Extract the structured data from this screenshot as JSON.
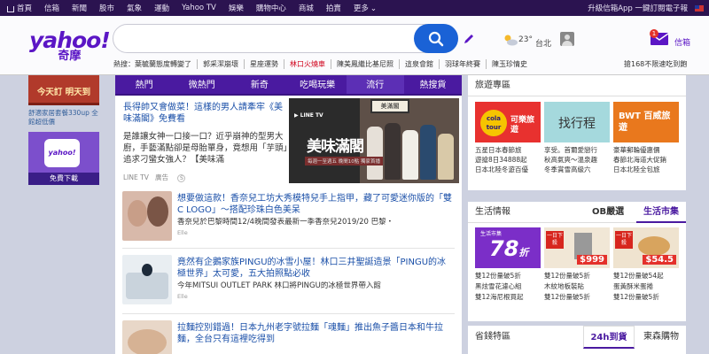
{
  "topnav": {
    "items": [
      "首頁",
      "信箱",
      "新聞",
      "股市",
      "氣象",
      "運動",
      "Yahoo TV",
      "娛樂",
      "購物中心",
      "商城",
      "拍賣",
      "更多"
    ],
    "more_chevron": "⌄",
    "right_label": "升級信箱App 一鍵訂閱電子報"
  },
  "logo": {
    "text": "yahoo!",
    "sub": "奇摩"
  },
  "search": {
    "placeholder": "",
    "value": ""
  },
  "weather": {
    "temp": "23°",
    "city": "台北"
  },
  "mail": {
    "badge": "1",
    "label": "信箱"
  },
  "hot_searches": {
    "label": "熱搜：",
    "items": [
      "葉毓蘭態度轉變了",
      "郭采潔崩壞",
      "星座運勢",
      "林口火燒車",
      "陳美鳳繼比基尼照",
      "這泉會館",
      "羽球年終賽",
      "陳玉珍情史"
    ],
    "right": "搶168不限速吃到飽"
  },
  "left_ads": {
    "banner1_top": "今天訂 明天到",
    "banner1_big": "今天訂 明天到",
    "text": "舒適家居套餐330up 全館超低價",
    "banner2_inner": "yahoo!",
    "banner2_dl": "免費下載"
  },
  "tabs": [
    "熱門",
    "微熱門",
    "新奇",
    "吃喝玩樂",
    "流行",
    "熱搜貨"
  ],
  "hero": {
    "title": "長得帥又會做菜！這樣的男人請牽牢《美味滿閣》免費看",
    "desc": "是誰讓女神一口接一口？近乎崩神的型男大廚，手藝滿點卻是母胎單身，竟想用「芋頭」追求刁蠻女強人？【美味滿",
    "source": "LINE TV",
    "ad": "廣告",
    "img_logo": "▶ LINE TV",
    "img_show": "美味滿閣",
    "img_sub": "每週一至週五 晚間10點 獨家首播",
    "img_sign": "美滿閣"
  },
  "feed": [
    {
      "title": "想要做這款！香奈兒工坊大秀模特兒手上指甲，藏了可愛迷你版的「雙C LOGO」～搭配珍珠白色美呆",
      "desc": "香奈兒於巴黎時間12/4晚間發表最新一季香奈兒2019/20 巴黎・",
      "source": "Elle"
    },
    {
      "title": "竟然有企鵝家族PINGU的冰雪小屋！林口三井聖誕造景「PINGU的冰極世界」太可愛，五大拍照點必收",
      "desc": "今年MITSUI OUTLET PARK 林口將PINGU的冰極世界帶入館",
      "source": "Elle"
    },
    {
      "title": "拉麵控別錯過！日本九州老字號拉麵「魂麵」推出魚子醬日本和牛拉麵，全台只有這裡吃得到",
      "desc": "",
      "source": ""
    }
  ],
  "travel": {
    "header": "旅遊專區",
    "cards": [
      {
        "brand": "可樂旅遊",
        "logo_text": "cola tour",
        "text1": "五星日本春節旅",
        "text2": "遊搶8日34888起"
      },
      {
        "brand": "找行程",
        "logo_text": "找行程",
        "text1": "享受。首爾愛戀行",
        "text2": "秋高氣爽～溫泉趣"
      },
      {
        "brand": "百威旅遊",
        "logo_text": "BWT 百威旅遊",
        "text1": "豪華郵輪優惠價",
        "text2": "春節北海道大促銷"
      }
    ],
    "card_extra": [
      "日本北陸冬遊百優",
      "冬季賞雪高級六",
      "日本北陸全包旅"
    ]
  },
  "life": {
    "header": "生活情報",
    "tab_ob": "OB嚴選",
    "tab_market": "生活市集",
    "cards": [
      {
        "badge": "生活市集",
        "big": "78",
        "unit": "折",
        "line1": "雙12份量破5折",
        "line2": "黑炫雪花濾心組",
        "line3": "雙12海尼根買起"
      },
      {
        "badge": "一日下殺",
        "price": "$999",
        "line1": "雙12份量破5折",
        "line2": "木紋地板裝貼",
        "line3": "雙12份量破5折"
      },
      {
        "badge": "一日下殺",
        "price": "$54.5",
        "line1": "雙12份量破54起",
        "line2": "蛋黃酥米蛋捲",
        "line3": "雙12份量破5折"
      }
    ]
  },
  "province": {
    "header": "省錢特區",
    "tab1": "24h到貨",
    "tab2": "東森購物"
  },
  "colors": {
    "brand": "#5b16c5",
    "topbar": "#2b1350",
    "tabs": "#4a1aa0",
    "link": "#1a4fa8",
    "search_btn": "#1a62d6"
  }
}
